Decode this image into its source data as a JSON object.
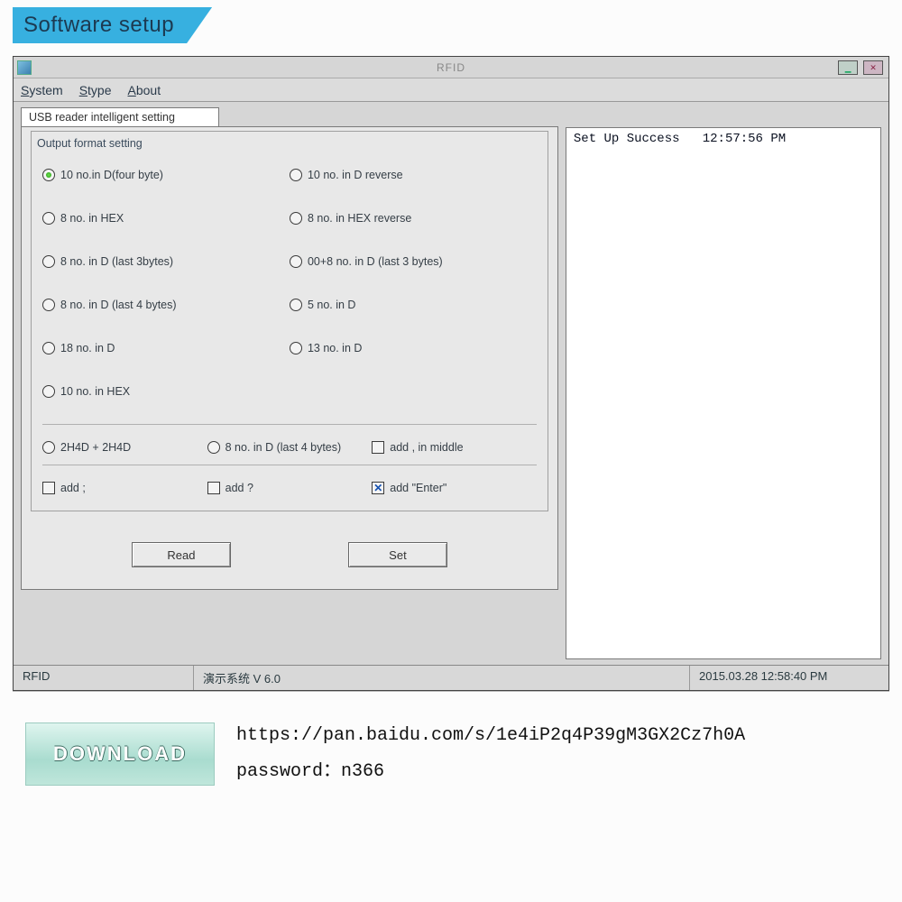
{
  "banner": {
    "title": "Software setup"
  },
  "window": {
    "title": "RFID",
    "menu": {
      "system": "System",
      "stype": "Stype",
      "about": "About"
    },
    "tab": "USB reader intelligent setting",
    "group_title": "Output format setting",
    "radios": {
      "left": [
        "10 no.in D(four byte)",
        "8 no. in HEX",
        "8 no. in D (last 3bytes)",
        "8 no. in D (last 4 bytes)",
        "18 no. in D",
        "10 no. in HEX"
      ],
      "right": [
        "10 no. in D reverse",
        "8 no. in HEX reverse",
        "00+8 no. in D (last 3 bytes)",
        "5 no. in D",
        "13 no. in D"
      ],
      "row3": {
        "a": "2H4D + 2H4D",
        "b": "8 no. in D (last 4 bytes)"
      }
    },
    "checks": {
      "middle": "add , in middle",
      "semi": "add ;",
      "qmark": "add ?",
      "enter": "add \"Enter\""
    },
    "buttons": {
      "read": "Read",
      "set": "Set"
    },
    "log": {
      "msg": "Set Up Success",
      "time": "12:57:56 PM"
    },
    "status": {
      "left": "RFID",
      "mid": "演示系统  V 6.0",
      "right": "2015.03.28  12:58:40 PM"
    }
  },
  "download": {
    "label": "DOWNLOAD",
    "url": "https://pan.baidu.com/s/1e4iP2q4P39gM3GX2Cz7h0A",
    "password_label": "password：",
    "password": "n366"
  }
}
